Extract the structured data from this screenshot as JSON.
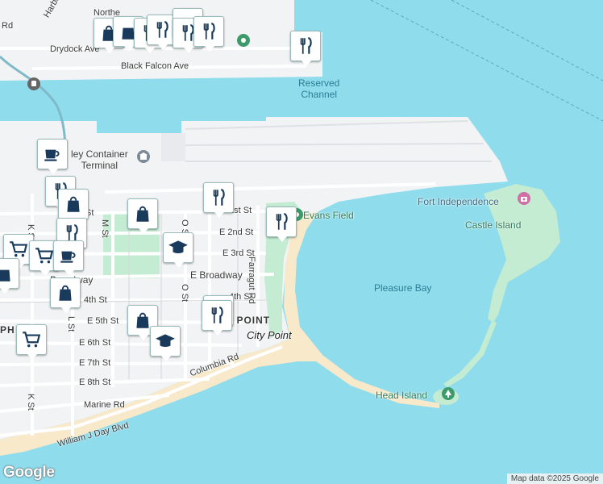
{
  "map": {
    "colors": {
      "water": "#8fdcec",
      "land": "#f1f3f4",
      "park": "#c3ecd2",
      "beach": "#f7e9c9",
      "road": "#ffffff",
      "pin_icon": "#1a3a5c"
    },
    "streets": {
      "harbor_st": "Harbor St",
      "northern": "Northe",
      "drydock": "Drydock Ave",
      "black_falcon": "Black Falcon Ave",
      "rd": "Rd",
      "e_1st": "1st St",
      "e_1st_left": "St",
      "e_2nd": "E 2nd St",
      "e_3rd": "E 3rd St",
      "e_broadway": "E Broadway",
      "broadway_left": "Broadway",
      "e_4th": "4th St",
      "e_4th_left": "4th St",
      "e_5th": "E 5th St",
      "e_6th": "E 6th St",
      "e_7th": "E 7th St",
      "e_8th": "E 8th St",
      "marine": "Marine Rd",
      "columbia": "Columbia Rd",
      "wjday": "William J Day Blvd",
      "farragut": "Farragut Rd",
      "m_st": "M St",
      "o_st": "O St",
      "o_st2": "O St",
      "l_st": "L St",
      "k_st": "K St",
      "k_st2": "K St",
      "ph": "PH"
    },
    "places": {
      "reserved_channel": "Reserved\nChannel",
      "container_terminal": "ley Container\nTerminal",
      "evans_field": "Evans Field",
      "fort_independence": "Fort Independence",
      "castle_island": "Castle Island",
      "pleasure_bay": "Pleasure Bay",
      "head_island": "Head Island",
      "city_point": "City Point",
      "city_point_area": "CITY POINT"
    },
    "pins": [
      {
        "type": "shopping-bag",
        "label": "Shopping"
      },
      {
        "type": "restaurant",
        "label": "Restaurant"
      },
      {
        "type": "coffee",
        "label": "Cafe"
      },
      {
        "type": "school",
        "label": "School"
      },
      {
        "type": "grocery",
        "label": "Grocery"
      }
    ],
    "logo": "Google",
    "attribution": "Map data ©2025 Google"
  }
}
